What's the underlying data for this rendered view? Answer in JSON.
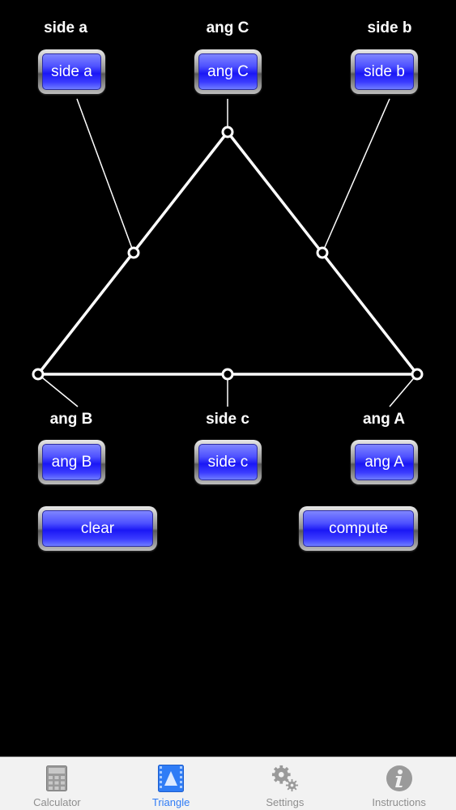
{
  "labels": {
    "side_a": "side a",
    "ang_C": "ang C",
    "side_b": "side b",
    "ang_B": "ang B",
    "side_c": "side c",
    "ang_A": "ang A"
  },
  "buttons": {
    "side_a": "side a",
    "ang_C": "ang C",
    "side_b": "side b",
    "ang_B": "ang B",
    "side_c": "side c",
    "ang_A": "ang A",
    "clear": "clear",
    "compute": "compute"
  },
  "colors": {
    "button_face": "#2a2aff",
    "active_tab": "#2f7cf6",
    "inactive_tab": "#8e8e8e",
    "background": "#000000"
  },
  "tabs": [
    {
      "label": "Calculator",
      "icon": "calculator-icon",
      "active": false
    },
    {
      "label": "Triangle",
      "icon": "triangle-icon",
      "active": true
    },
    {
      "label": "Settings",
      "icon": "gear-icon",
      "active": false
    },
    {
      "label": "Instructions",
      "icon": "info-icon",
      "active": false
    }
  ]
}
